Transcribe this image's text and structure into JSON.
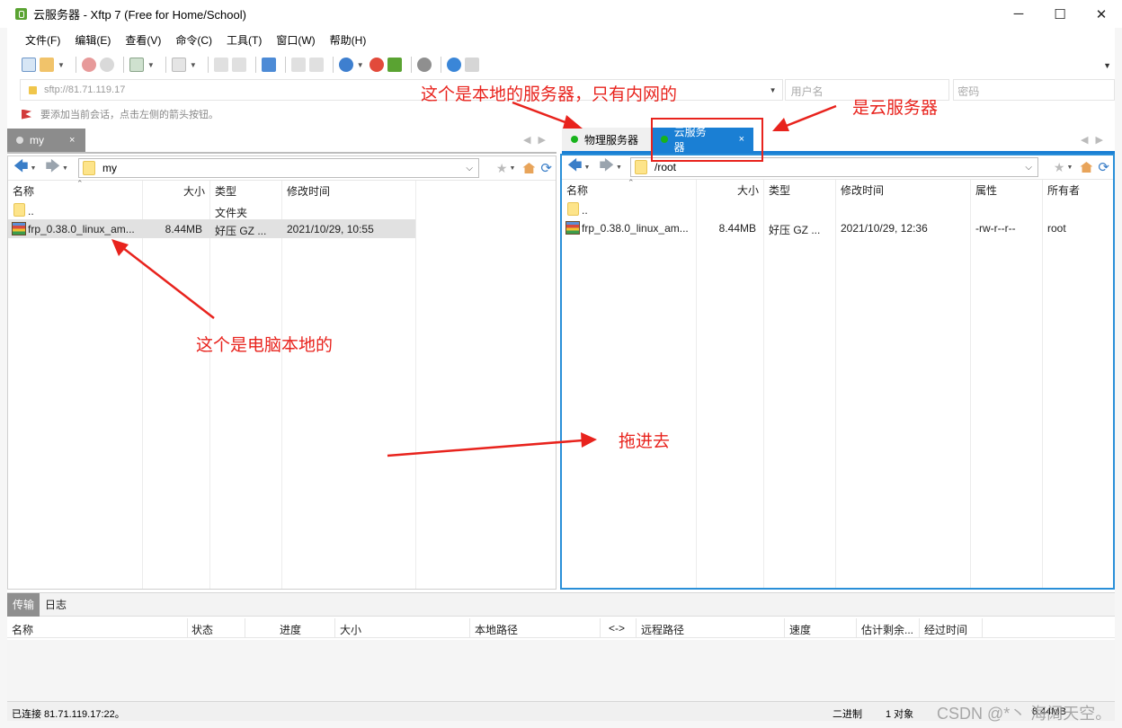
{
  "window": {
    "title": "云服务器 - Xftp 7 (Free for Home/School)",
    "minimize": "─",
    "maximize": "☐",
    "close": "✕"
  },
  "menu": [
    "文件(F)",
    "编辑(E)",
    "查看(V)",
    "命令(C)",
    "工具(T)",
    "窗口(W)",
    "帮助(H)"
  ],
  "address": {
    "host": "sftp://81.71.119.17",
    "user_placeholder": "用户名",
    "password_placeholder": "密码"
  },
  "hint": "要添加当前会话，点击左侧的箭头按钮。",
  "left_pane": {
    "tab_label": "my",
    "tab_close": "×",
    "path": "my",
    "columns": [
      "名称",
      "大小",
      "类型",
      "修改时间"
    ],
    "rows": [
      {
        "name": "..",
        "size": "",
        "type": "文件夹",
        "modified": ""
      },
      {
        "name": "frp_0.38.0_linux_am...",
        "size": "8.44MB",
        "type": "好压 GZ ...",
        "modified": "2021/10/29, 10:55"
      }
    ]
  },
  "right_pane": {
    "tabs": [
      {
        "label": "物理服务器",
        "active": false
      },
      {
        "label": "云服务器",
        "active": true,
        "close": "×"
      }
    ],
    "path": "/root",
    "columns": [
      "名称",
      "大小",
      "类型",
      "修改时间",
      "属性",
      "所有者"
    ],
    "rows": [
      {
        "name": "..",
        "size": "",
        "type": "",
        "modified": "",
        "attr": "",
        "owner": ""
      },
      {
        "name": "frp_0.38.0_linux_am...",
        "size": "8.44MB",
        "type": "好压 GZ ...",
        "modified": "2021/10/29, 12:36",
        "attr": "-rw-r--r--",
        "owner": "root"
      }
    ]
  },
  "transfer": {
    "tabs": [
      "传输",
      "日志"
    ],
    "columns": [
      "名称",
      "状态",
      "进度",
      "大小",
      "本地路径",
      "<->",
      "远程路径",
      "速度",
      "估计剩余...",
      "经过时间"
    ]
  },
  "status": {
    "connection": "已连接 81.71.119.17:22。",
    "mode": "二进制",
    "objects": "1 对象",
    "size": "8.44MB"
  },
  "watermark": "CSDN @*丶 海阔天空。",
  "annotations": {
    "local_server": "这个是本地的服务器，只有内网的",
    "cloud_server": "是云服务器",
    "local_pc": "这个是电脑本地的",
    "drag_in": "拖进去"
  },
  "colors": {
    "accent": "#1a7fd4",
    "annotation": "#e8231d",
    "status_dot": "#18b31c"
  }
}
